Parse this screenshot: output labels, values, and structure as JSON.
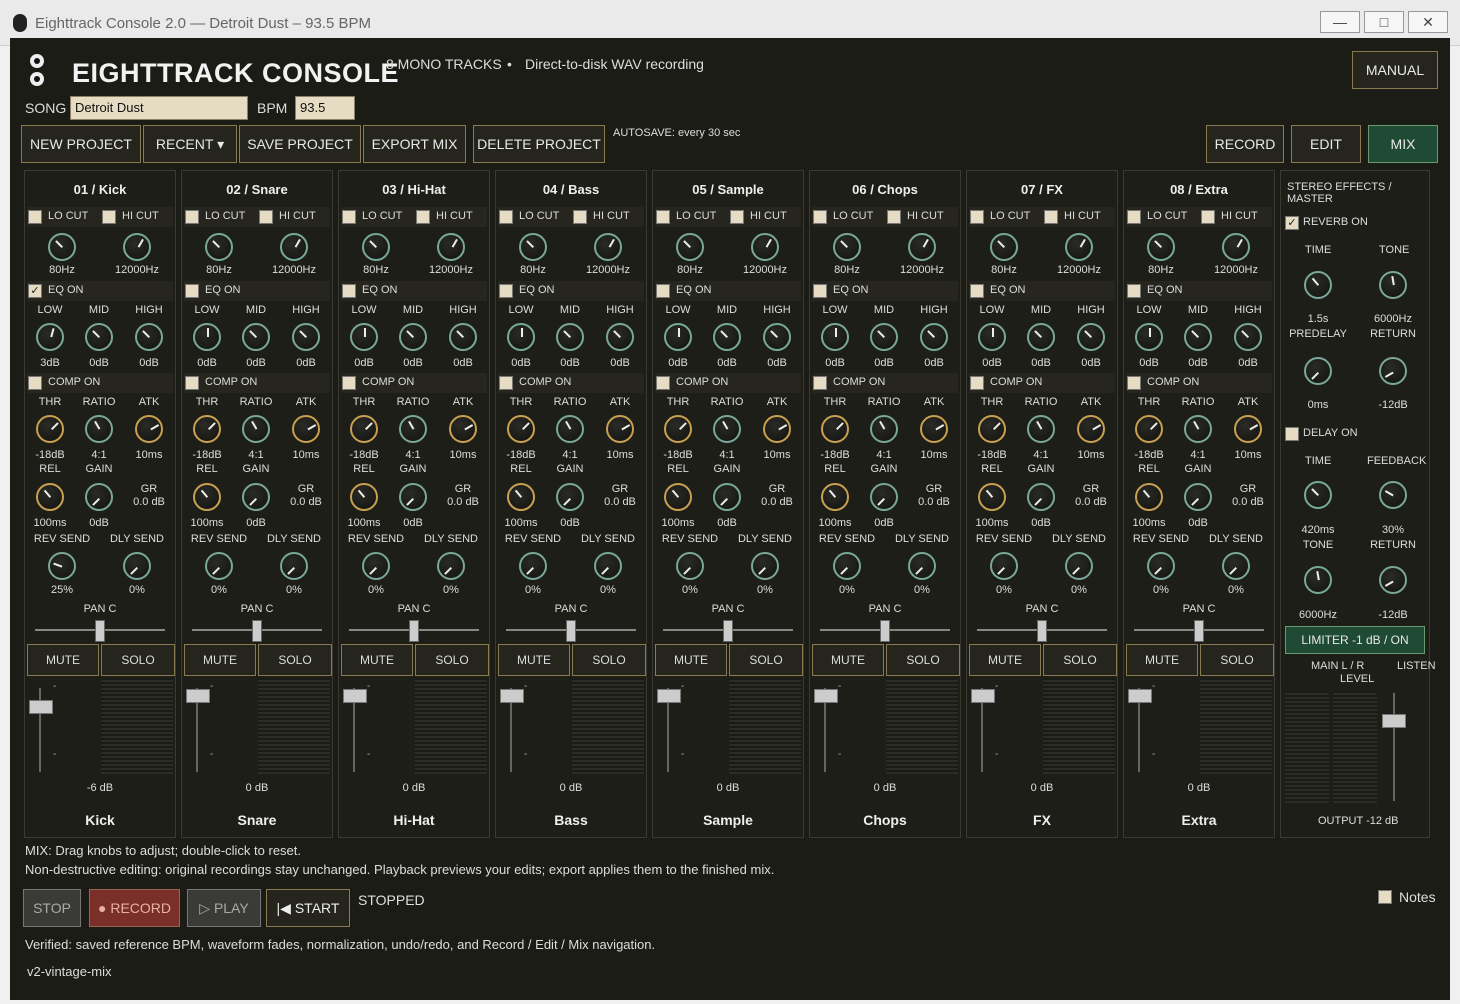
{
  "window": {
    "title": "Eighttrack Console 2.0 — Detroit Dust – 93.5 BPM",
    "min": "—",
    "max": "□",
    "close": "✕"
  },
  "header": {
    "title": "EIGHTTRACK CONSOLE",
    "tracks_info": "8 MONO TRACKS",
    "bullet": "•",
    "recording_info": "Direct-to-disk WAV recording",
    "manual_label": "MANUAL",
    "song_label": "SONG",
    "song_value": "Detroit Dust",
    "bpm_label": "BPM",
    "bpm_value": "93.5"
  },
  "toolbar": {
    "new": "NEW PROJECT",
    "recent": "RECENT ▾",
    "save": "SAVE PROJECT",
    "export": "EXPORT MIX",
    "delete": "DELETE PROJECT",
    "autosave": "AUTOSAVE: every 30 sec",
    "record": "RECORD",
    "edit": "EDIT",
    "mix": "MIX"
  },
  "labels": {
    "lo_cut": "LO CUT",
    "hi_cut": "HI CUT",
    "eq_on": "EQ ON",
    "low": "LOW",
    "mid": "MID",
    "high": "HIGH",
    "comp_on": "COMP ON",
    "thr": "THR",
    "ratio": "RATIO",
    "atk": "ATK",
    "rel": "REL",
    "gain": "GAIN",
    "gr": "GR",
    "rev_send": "REV SEND",
    "dly_send": "DLY SEND",
    "pan": "PAN C",
    "mute": "MUTE",
    "solo": "SOLO",
    "lo_freq": "80Hz",
    "hi_freq": "12000Hz",
    "thr_val": "-18dB",
    "ratio_val": "4:1",
    "atk_val": "10ms",
    "rel_val": "100ms",
    "gain_val": "0dB",
    "gr_val": "0.0 dB",
    "send_zero": "0%",
    "tick": "-"
  },
  "tracks": [
    {
      "header": "01 / Kick",
      "name": "Kick",
      "eq_on": true,
      "low": "3dB",
      "mid": "0dB",
      "high": "0dB",
      "rev": "25%",
      "dly": "0%",
      "level": "-6 dB"
    },
    {
      "header": "02 / Snare",
      "name": "Snare",
      "eq_on": false,
      "low": "0dB",
      "mid": "0dB",
      "high": "0dB",
      "rev": "0%",
      "dly": "0%",
      "level": "0 dB"
    },
    {
      "header": "03 / Hi-Hat",
      "name": "Hi-Hat",
      "eq_on": false,
      "low": "0dB",
      "mid": "0dB",
      "high": "0dB",
      "rev": "0%",
      "dly": "0%",
      "level": "0 dB"
    },
    {
      "header": "04 / Bass",
      "name": "Bass",
      "eq_on": false,
      "low": "0dB",
      "mid": "0dB",
      "high": "0dB",
      "rev": "0%",
      "dly": "0%",
      "level": "0 dB"
    },
    {
      "header": "05 / Sample",
      "name": "Sample",
      "eq_on": false,
      "low": "0dB",
      "mid": "0dB",
      "high": "0dB",
      "rev": "0%",
      "dly": "0%",
      "level": "0 dB"
    },
    {
      "header": "06 / Chops",
      "name": "Chops",
      "eq_on": false,
      "low": "0dB",
      "mid": "0dB",
      "high": "0dB",
      "rev": "0%",
      "dly": "0%",
      "level": "0 dB"
    },
    {
      "header": "07 / FX",
      "name": "FX",
      "eq_on": false,
      "low": "0dB",
      "mid": "0dB",
      "high": "0dB",
      "rev": "0%",
      "dly": "0%",
      "level": "0 dB"
    },
    {
      "header": "08 / Extra",
      "name": "Extra",
      "eq_on": false,
      "low": "0dB",
      "mid": "0dB",
      "high": "0dB",
      "rev": "0%",
      "dly": "0%",
      "level": "0 dB"
    }
  ],
  "master": {
    "title": "STEREO EFFECTS / MASTER",
    "reverb_on": "REVERB ON",
    "time": "TIME",
    "tone": "TONE",
    "rev_time": "1.5s",
    "rev_tone": "6000Hz",
    "predelay": "PREDELAY",
    "return": "RETURN",
    "predelay_val": "0ms",
    "rev_return": "-12dB",
    "delay_on": "DELAY ON",
    "feedback": "FEEDBACK",
    "dly_time": "420ms",
    "dly_feedback": "30%",
    "dly_tone": "6000Hz",
    "dly_return": "-12dB",
    "limiter": "LIMITER  -1 dB  /  ON",
    "main": "MAIN L / R",
    "listen": "LISTEN",
    "level": "LEVEL",
    "output": "OUTPUT  -12 dB"
  },
  "footer": {
    "help1": "MIX: Drag knobs to adjust; double-click to reset.",
    "help2": "Non-destructive editing: original recordings stay unchanged. Playback previews your edits; export applies them to the finished mix.",
    "stop": "STOP",
    "record": "● RECORD",
    "play": "▷ PLAY",
    "start": "|◀ START",
    "status": "STOPPED",
    "notes": "Notes",
    "verified": "Verified: saved reference BPM, waveform fades, normalization, undo/redo, and Record / Edit / Mix navigation.",
    "version": "v2-vintage-mix"
  }
}
